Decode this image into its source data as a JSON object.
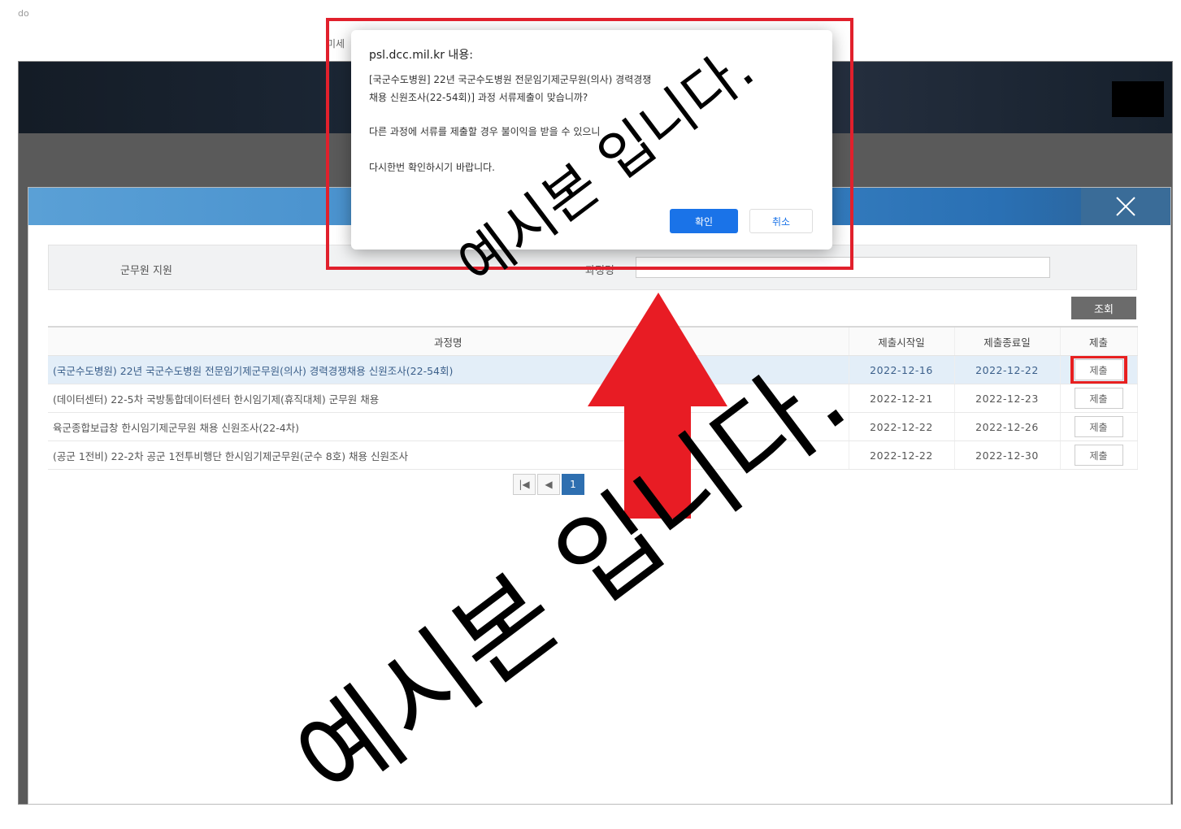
{
  "page": {
    "corner_label": "do",
    "ghost_text": "미세"
  },
  "dialog": {
    "origin": "psl.dcc.mil.kr 내용:",
    "lines": [
      "[국군수도병원] 22년 국군수도병원 전문임기제군무원(의사) 경력경쟁",
      "채용 신원조사(22-54회)] 과정 서류제출이 맞습니까?",
      "다른 과정에 서류를 제출할 경우 불이익을 받을 수 있으니",
      "다시한번 확인하시기 바랍니다."
    ],
    "ok_label": "확인",
    "cancel_label": "취소"
  },
  "modal": {
    "close_icon": "close-icon",
    "filter_label": "군무원 지원",
    "course_name_label": "과정명",
    "course_name_value": "",
    "search_label": "조회"
  },
  "table": {
    "headers": [
      "과정명",
      "제출시작일",
      "제출종료일",
      "제출"
    ],
    "rows": [
      {
        "name": "(국군수도병원) 22년 국군수도병원 전문임기제군무원(의사) 경력경쟁채용 신원조사(22-54회)",
        "start": "2022-12-16",
        "end": "2022-12-22",
        "action": "제출"
      },
      {
        "name": "(데이터센터) 22-5차 국방통합데이터센터 한시임기제(휴직대체) 군무원 채용",
        "start": "2022-12-21",
        "end": "2022-12-23",
        "action": "제출"
      },
      {
        "name": "육군종합보급창 한시임기제군무원 채용 신원조사(22-4차)",
        "start": "2022-12-22",
        "end": "2022-12-26",
        "action": "제출"
      },
      {
        "name": "(공군 1전비) 22-2차 공군 1전투비행단 한시임기제군무원(군수 8호) 채용 신원조사",
        "start": "2022-12-22",
        "end": "2022-12-30",
        "action": "제출"
      }
    ]
  },
  "pager": {
    "first": "|◀",
    "prev": "◀",
    "current": "1"
  },
  "watermark": {
    "text": "예시본 입니다."
  },
  "colors": {
    "highlight": "#e1202c",
    "arrow": "#e81c24",
    "header_blue": "#3e88c8",
    "dialog_button": "#1a73e8"
  }
}
